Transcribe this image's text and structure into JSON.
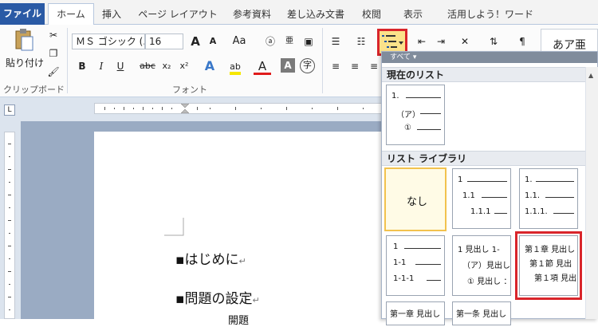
{
  "tabs": [
    "ファイル",
    "ホーム",
    "挿入",
    "ページ レイアウト",
    "参考資料",
    "差し込み文書",
    "校閲",
    "表示",
    "活用しよう！ワード"
  ],
  "ribbon": {
    "paste_label": "貼り付け",
    "clipboard_group": "クリップボード",
    "font_group": "フォント",
    "font_name": "ＭＳ ゴシック (.",
    "font_size": "16",
    "bold": "B",
    "italic": "I",
    "underline": "U",
    "strike": "abc",
    "subscript": "x₂",
    "superscript": "x²",
    "grow_font": "A",
    "shrink_font": "A",
    "change_case": "Aa",
    "text_effects": "A",
    "font_color": "A",
    "char_shading": "A",
    "enclose_char": "字",
    "style_preview": "あア亜"
  },
  "document": {
    "lines": [
      "▪はじめに",
      "▪問題の設定",
      "開題"
    ]
  },
  "dropdown": {
    "top_label": "すべて ▾",
    "current_list_header": "現在のリスト",
    "library_header": "リスト ライブラリ",
    "current_list": [
      "1.",
      "（ア）",
      "①"
    ],
    "none_label": "なし",
    "tile_num1": [
      "1",
      "1.1",
      "1.1.1"
    ],
    "tile_num2": [
      "1.",
      "1.1.",
      "1.1.1."
    ],
    "tile_dash": [
      "1",
      "1-1",
      "1-1-1"
    ],
    "tile_heading1": [
      "1 見出し 1-",
      "（ア）見出し",
      "① 見出し ："
    ],
    "tile_chapter": [
      "第１章 見出し",
      "第１節 見出",
      "第１項 見出"
    ],
    "tile_partial": [
      "第一章 見出し",
      "第一条 見出し"
    ]
  },
  "colors": {
    "file_tab": "#2a5aa5",
    "highlight": "#d9252b",
    "selected": "#f2c24e"
  }
}
